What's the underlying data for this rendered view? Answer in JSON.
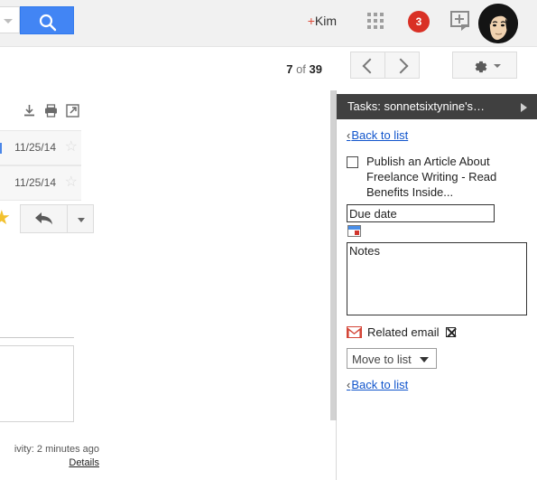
{
  "header": {
    "search_placeholder": "",
    "search_icon": "search-icon",
    "dropdown_icon": "chevron-down-icon",
    "plus_name": "+Kim",
    "apps_icon": "apps-grid-icon",
    "notification_count": "3",
    "share_icon": "share-post-icon",
    "avatar_alt": "user-avatar"
  },
  "toolbar": {
    "page_position": "7",
    "page_of": " of ",
    "page_total": "39",
    "prev_label": "Older",
    "next_label": "Newer",
    "settings_icon": "gear-icon"
  },
  "mail": {
    "actions": {
      "download": "download-icon",
      "print": "print-icon",
      "popout": "open-in-new-window-icon"
    },
    "messages": [
      {
        "date": "11/25/14",
        "star": "☆"
      },
      {
        "date": "11/25/14",
        "star": "☆"
      }
    ],
    "starred_glyph": "★",
    "reply_icon": "reply-arrow-icon",
    "reply_more_icon": "chevron-down-icon",
    "footer_activity": "ivity: 2 minutes ago",
    "footer_details": "Details"
  },
  "tasks": {
    "panel_title": "Tasks: sonnetsixtynine's…",
    "expand_icon": "expand-arrow-icon",
    "back_to_list_top": "Back to list",
    "back_to_list_bottom": "Back to list",
    "back_chevron": "‹",
    "task_text": "Publish an Article About Freelance Writing - Read Benefits Inside...",
    "checkbox_checked": false,
    "due_date_value": "Due date",
    "calendar_icon": "calendar-picker-icon",
    "notes_value": "Notes",
    "related_email_label": "Related email",
    "related_email_icon": "gmail-envelope-icon",
    "remove_related_icon": "close-x-icon",
    "move_to_list_value": "Move to list",
    "move_to_list_caret": "chevron-down-icon"
  },
  "colors": {
    "accent_blue": "#4285f4",
    "badge_red": "#d93025",
    "gmail_red": "#d44638",
    "panel_dark": "#404040",
    "link_blue": "#1155cc",
    "star_gold": "#f2c12e"
  }
}
